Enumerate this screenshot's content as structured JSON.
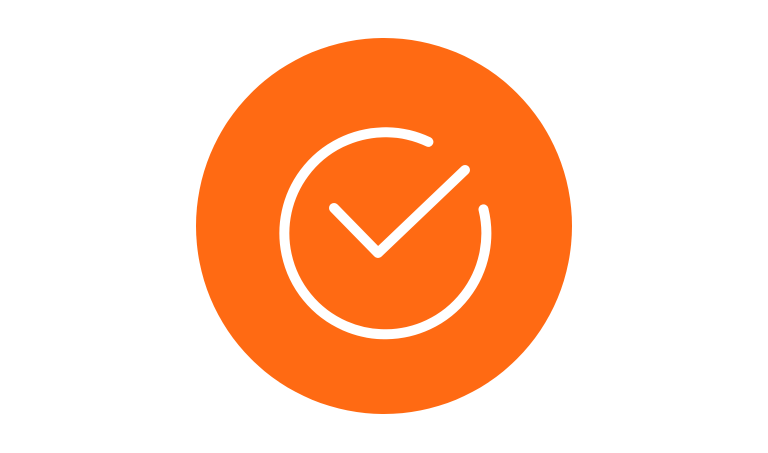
{
  "icon": {
    "name": "check-circle-icon",
    "badge_color": "#ff6a13",
    "stroke_color": "#ffffff",
    "background_color": "#ffffff"
  }
}
